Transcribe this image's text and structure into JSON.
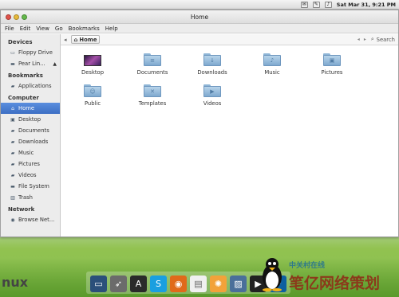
{
  "top_panel": {
    "datetime": "Sat Mar 31,  9:21 PM",
    "icons": [
      "apple-menu-icon",
      "mail-icon",
      "edit-icon",
      "volume-icon"
    ]
  },
  "window": {
    "title": "Home",
    "menu": [
      "File",
      "Edit",
      "View",
      "Go",
      "Bookmarks",
      "Help"
    ]
  },
  "sidebar": {
    "sections": [
      {
        "title": "Devices",
        "items": [
          {
            "label": "Floppy Drive",
            "icon": "floppy-icon"
          },
          {
            "label": "Pear Lin...",
            "icon": "drive-icon",
            "eject": "▲"
          }
        ]
      },
      {
        "title": "Bookmarks",
        "items": [
          {
            "label": "Applications",
            "icon": "folder-icon"
          }
        ]
      },
      {
        "title": "Computer",
        "items": [
          {
            "label": "Home",
            "icon": "home-icon",
            "selected": true
          },
          {
            "label": "Desktop",
            "icon": "desktop-icon"
          },
          {
            "label": "Documents",
            "icon": "folder-icon"
          },
          {
            "label": "Downloads",
            "icon": "folder-icon"
          },
          {
            "label": "Music",
            "icon": "folder-icon"
          },
          {
            "label": "Pictures",
            "icon": "folder-icon"
          },
          {
            "label": "Videos",
            "icon": "folder-icon"
          },
          {
            "label": "File System",
            "icon": "drive-icon"
          },
          {
            "label": "Trash",
            "icon": "trash-icon"
          }
        ]
      },
      {
        "title": "Network",
        "items": [
          {
            "label": "Browse Net...",
            "icon": "network-icon"
          }
        ]
      }
    ]
  },
  "toolbar": {
    "breadcrumb": "Home",
    "search_label": "Search"
  },
  "files": [
    {
      "label": "Desktop",
      "kind": "desktop"
    },
    {
      "label": "Documents",
      "kind": "folder",
      "glyph": "≡"
    },
    {
      "label": "Downloads",
      "kind": "folder",
      "glyph": "↓"
    },
    {
      "label": "Music",
      "kind": "folder",
      "glyph": "♪"
    },
    {
      "label": "Pictures",
      "kind": "folder",
      "glyph": "▣"
    },
    {
      "label": "Public",
      "kind": "folder",
      "glyph": "☺"
    },
    {
      "label": "Templates",
      "kind": "folder",
      "glyph": "✕"
    },
    {
      "label": "Videos",
      "kind": "folder",
      "glyph": "▶"
    }
  ],
  "dock": [
    "monitor-icon",
    "rocket-icon",
    "app-store-icon",
    "skype-icon",
    "firefox-icon",
    "document-icon",
    "orange-icon",
    "photos-icon",
    "video-icon",
    "tux-icon"
  ],
  "branding": {
    "nux": "nux",
    "watermark_small": "中关村在线",
    "watermark_big": "笔亿网络策划"
  }
}
